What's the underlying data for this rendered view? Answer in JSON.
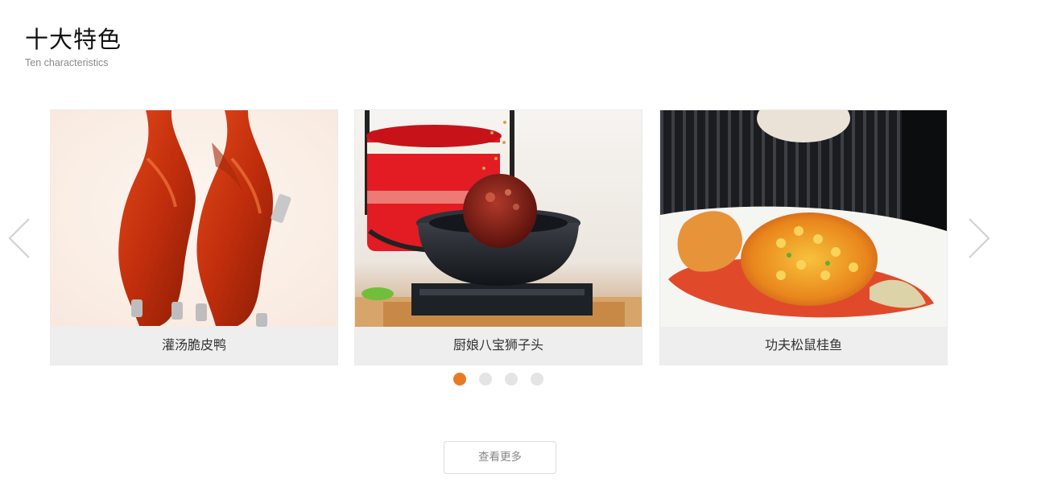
{
  "section": {
    "title": "十大特色",
    "subtitle": "Ten characteristics"
  },
  "carousel": {
    "prev_icon": "chevron-left-icon",
    "next_icon": "chevron-right-icon",
    "items": [
      {
        "caption": "灌汤脆皮鸭",
        "image": "roast-duck-photo"
      },
      {
        "caption": "厨娘八宝狮子头",
        "image": "lion-head-meatball-photo"
      },
      {
        "caption": "功夫松鼠桂鱼",
        "image": "squirrel-mandarin-fish-photo"
      }
    ],
    "pagination": {
      "count": 4,
      "active": 1
    }
  },
  "more_button": {
    "label": "查看更多"
  },
  "colors": {
    "accent": "#e87a24",
    "dot_inactive": "#e4e4e4",
    "caption_bg": "#eeeeee"
  }
}
